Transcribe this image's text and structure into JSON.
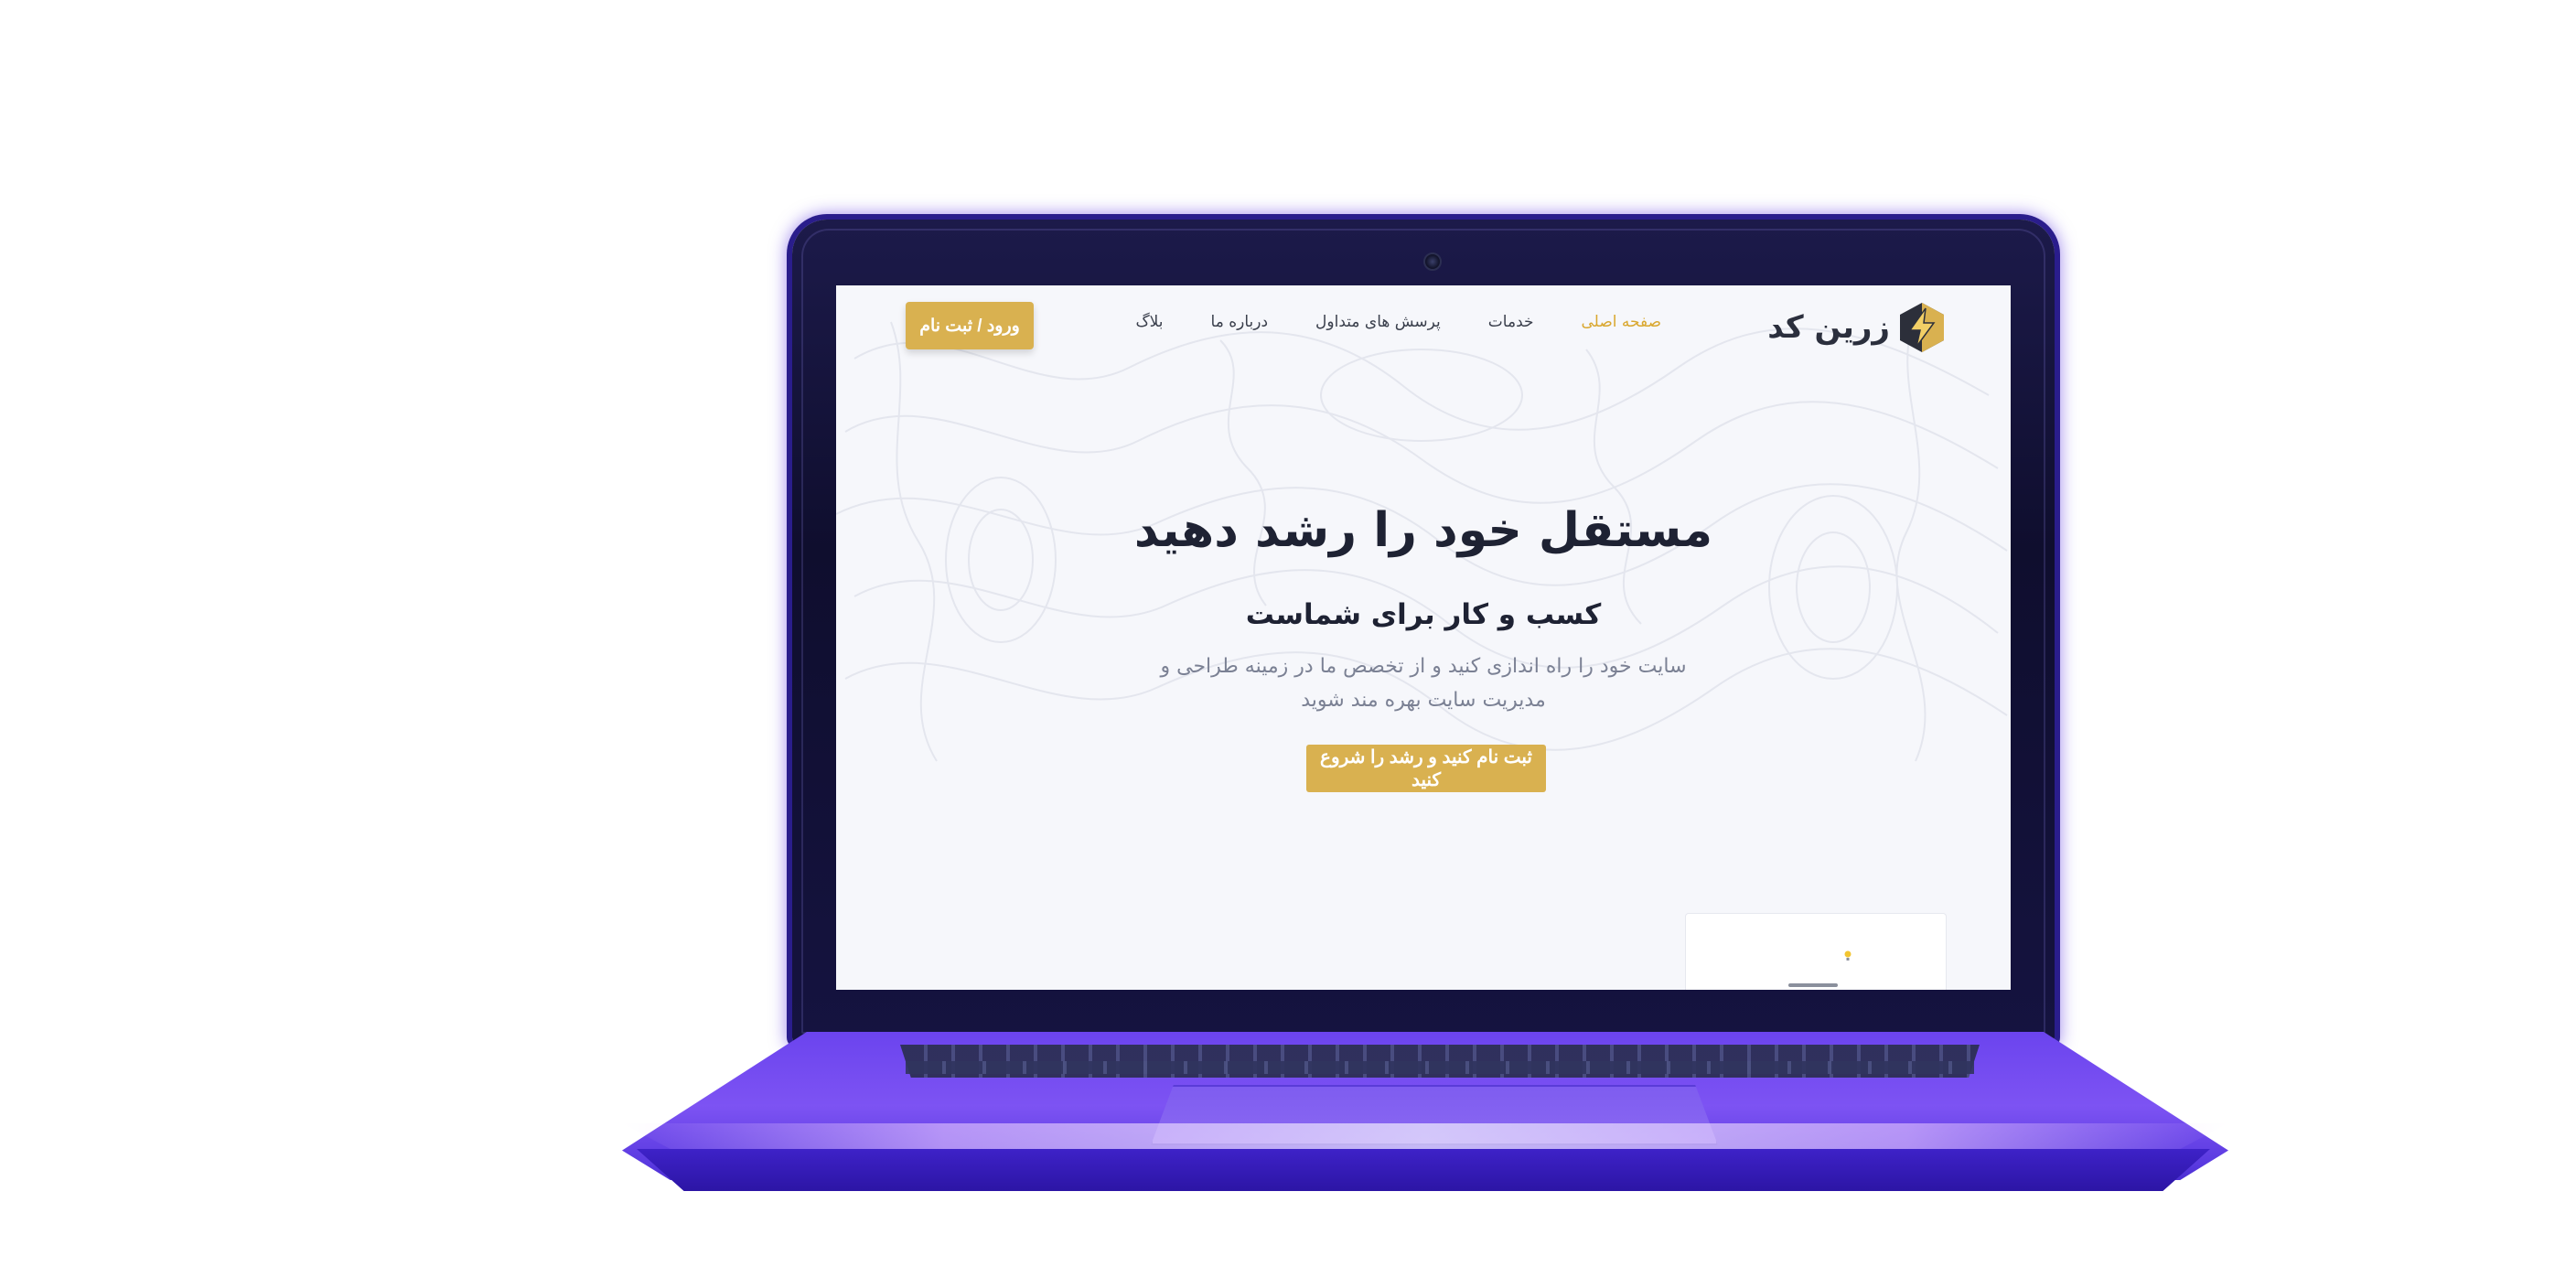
{
  "brand": {
    "name": "زرین کد",
    "primary_color": "#d9b150",
    "accent_color": "#d9a72e"
  },
  "nav": {
    "items": [
      {
        "label": "صفحه اصلی",
        "active": true
      },
      {
        "label": "خدمات",
        "active": false
      },
      {
        "label": "پرسش های متداول",
        "active": false
      },
      {
        "label": "درباره ما",
        "active": false
      },
      {
        "label": "بلاگ",
        "active": false
      }
    ],
    "login_label": "ورود / ثبت نام"
  },
  "hero": {
    "title": "مستقل خود را رشد دهید",
    "subtitle": "کسب و کار برای شماست",
    "description": "سایت خود را راه اندازی کنید و از تخصص ما در زمینه طراحی و مدیریت سایت بهره مند شوید",
    "cta_label": "ثبت نام کنید و رشد را شروع کنید"
  },
  "icons": {
    "logo": "lightning-bolt-icon",
    "card": "lightbulb-icon"
  }
}
